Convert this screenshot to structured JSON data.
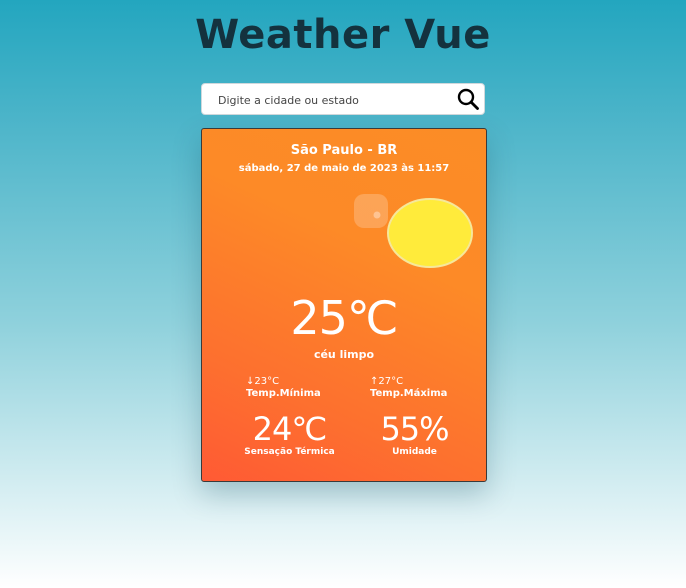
{
  "app": {
    "title": "Weather Vue"
  },
  "search": {
    "placeholder": "Digite a cidade ou estado",
    "value": "",
    "icon": "search-icon"
  },
  "weather": {
    "city": "São Paulo - BR",
    "datetime": "sábado, 27 de maio de 2023 às 11:57",
    "icon": "clear-sky-sun-icon",
    "temperature": "25℃",
    "description": "céu limpo",
    "min_value": "↓23°C",
    "min_label": "Temp.Mínima",
    "max_value": "↑27°C",
    "max_label": "Temp.Máxima",
    "feels_like_value": "24℃",
    "feels_like_label": "Sensação Térmica",
    "humidity_value": "55%",
    "humidity_label": "Umidade"
  },
  "colors": {
    "card_gradient_start": "#fb8c26",
    "card_gradient_end": "#ff5a34",
    "sun": "#ffeb3b",
    "title": "#14323e"
  }
}
